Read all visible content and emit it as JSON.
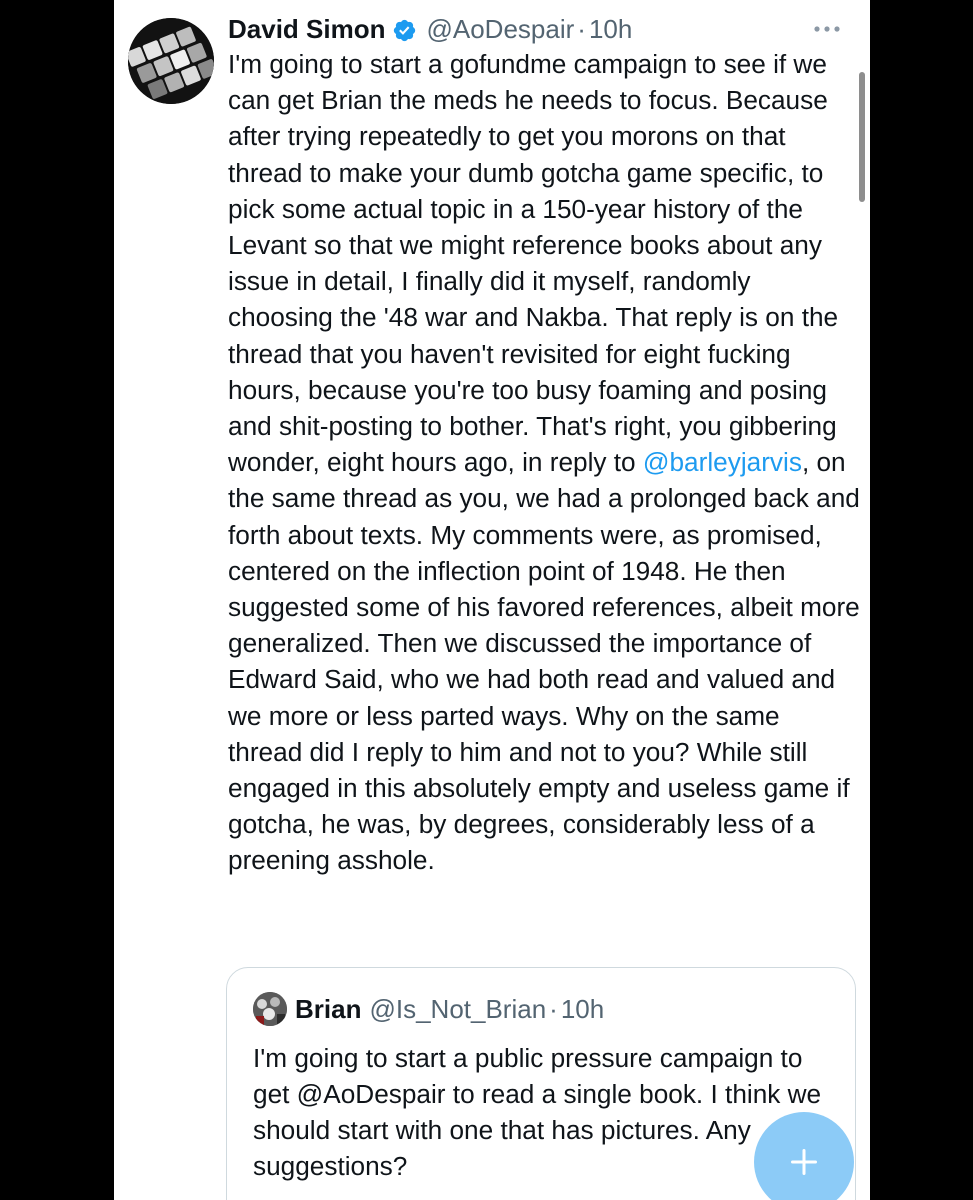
{
  "tweet": {
    "author": {
      "display_name": "David Simon",
      "handle": "@AoDespair",
      "verified": true
    },
    "separator": "·",
    "time": "10h",
    "body": {
      "part1": "I'm going to start a gofundme campaign to see if we can get Brian the meds he needs to focus. Because after trying repeatedly to get you morons on that thread to make your dumb gotcha game specific, to pick some actual topic in a 150-year history of the Levant so that we might reference books about any issue in detail, I finally did it myself, randomly choosing the '48 war and Nakba. That reply is on the thread that you haven't revisited for eight fucking hours, because you're too busy foaming and posing and shit-posting to bother. That's right, you gibbering wonder, eight hours ago, in reply to ",
      "mention": "@barleyjarvis",
      "part2": ", on the same thread as you, we had a prolonged back and forth about texts. My comments were, as promised, centered on the inflection point of 1948. He then suggested some of his favored references, albeit more generalized. Then we discussed the importance of Edward Said, who we had both read and valued and we more or less parted ways. Why on the same thread did I reply to him and not to you? While still engaged in this absolutely empty and useless game if gotcha, he was, by degrees, considerably less of a preening asshole."
    },
    "icons": {
      "verified": "verified-badge-icon",
      "more": "more-options-icon"
    }
  },
  "quoted_tweet": {
    "author": {
      "display_name": "Brian",
      "handle": "@Is_Not_Brian"
    },
    "separator": "·",
    "time": "10h",
    "text": "I'm going to start a public pressure campaign to get @AoDespair to read a single book. I think we should start with one that has pictures. Any suggestions?"
  },
  "compose_button": {
    "icon": "plus-icon"
  },
  "colors": {
    "accent": "#1d9bf0",
    "text": "#0f1419",
    "secondary_text": "#536471",
    "fab": "#8ccbf7",
    "card_border": "#cfd9de"
  }
}
